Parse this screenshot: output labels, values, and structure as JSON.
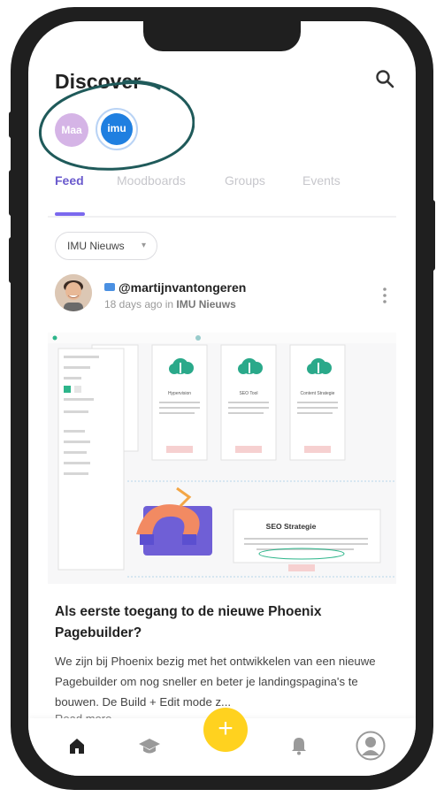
{
  "header": {
    "title": "Discover"
  },
  "stories": [
    {
      "label": "Maa",
      "bg": "#d5b4e6"
    },
    {
      "label": "imu",
      "bg": "#1f7fe0"
    }
  ],
  "tabs": [
    {
      "label": "Feed",
      "active": true
    },
    {
      "label": "Moodboards",
      "active": false
    },
    {
      "label": "Groups",
      "active": false
    },
    {
      "label": "Events",
      "active": false
    }
  ],
  "filter": {
    "label": "IMU Nieuws",
    "caret": "▾"
  },
  "post": {
    "author": "@martijnvantongeren",
    "time": "18 days ago in",
    "group": "IMU Nieuws",
    "title": "Als eerste toegang to de nieuwe Phoenix Pagebuilder?",
    "body": "We zijn bij Phoenix bezig met het ontwikkelen van een nieuwe Pagebuilder om nog sneller en beter je landingspagina's te bouwen. De Build + Edit mode z...",
    "read_more": "Read more",
    "preview": {
      "card_labels": [
        "Hypervision",
        "SEO Tool",
        "Content Strategie"
      ],
      "seo_title": "SEO Strategie"
    }
  },
  "fab": {
    "label": "+"
  },
  "colors": {
    "accent": "#7b68ee",
    "fab": "#ffd21f",
    "annotation": "#1f5a5a"
  }
}
